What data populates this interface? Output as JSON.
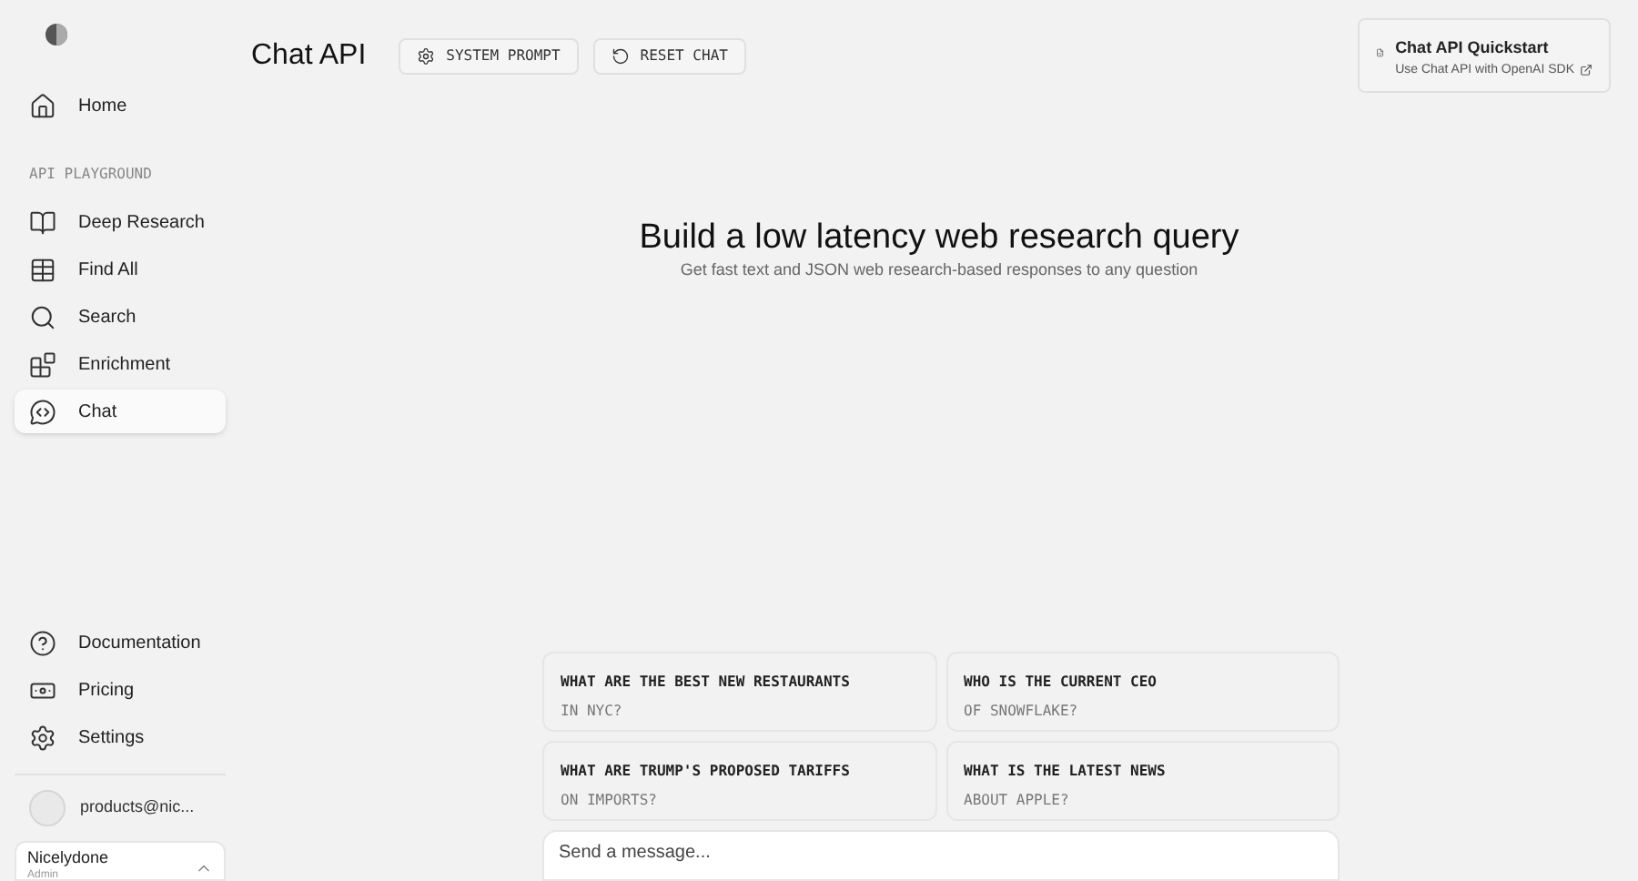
{
  "sidebar": {
    "nav": [
      {
        "label": "Home",
        "kind": "home",
        "selected": false
      }
    ],
    "section_label": "API PLAYGROUND",
    "playground": [
      {
        "label": "Deep Research",
        "kind": "book",
        "selected": false
      },
      {
        "label": "Find All",
        "kind": "table",
        "selected": false
      },
      {
        "label": "Search",
        "kind": "search",
        "selected": false
      },
      {
        "label": "Enrichment",
        "kind": "blocks",
        "selected": false
      },
      {
        "label": "Chat",
        "kind": "chat",
        "selected": true
      }
    ],
    "footer": [
      {
        "label": "Documentation",
        "kind": "help"
      },
      {
        "label": "Pricing",
        "kind": "money"
      },
      {
        "label": "Settings",
        "kind": "settings"
      }
    ],
    "account": {
      "email": "products@nic..."
    },
    "org": {
      "name": "Nicelydone",
      "role": "Admin"
    }
  },
  "header": {
    "title": "Chat API",
    "buttons": [
      {
        "label": "SYSTEM PROMPT",
        "kind": "settings"
      },
      {
        "label": "RESET CHAT",
        "kind": "reset"
      }
    ]
  },
  "quickstart": {
    "title": "Chat API Quickstart",
    "link": "Use Chat API with OpenAI SDK"
  },
  "hero": {
    "title": "Build a low latency web research query",
    "subtitle": "Get fast text and JSON web research-based responses to any question"
  },
  "suggestions": [
    {
      "line1": "WHAT ARE THE BEST NEW RESTAURANTS",
      "line2": "IN NYC?"
    },
    {
      "line1": "WHO IS THE CURRENT CEO",
      "line2": "OF SNOWFLAKE?"
    },
    {
      "line1": "WHAT ARE TRUMP'S PROPOSED TARIFFS",
      "line2": "ON IMPORTS?"
    },
    {
      "line1": "WHAT IS THE LATEST NEWS",
      "line2": "ABOUT APPLE?"
    }
  ],
  "composer": {
    "placeholder": "Send a message..."
  }
}
